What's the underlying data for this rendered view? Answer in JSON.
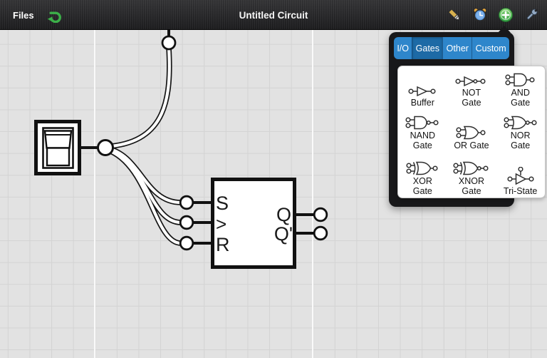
{
  "toolbar": {
    "files_label": "Files",
    "title": "Untitled Circuit",
    "icons": [
      "undo-arrow",
      "pen",
      "alarm-clock",
      "add-component",
      "wrench"
    ],
    "colors": {
      "undo_green": "#3cb049",
      "add_green": "#46b352",
      "bar_dark": "#1b1b1d"
    }
  },
  "palette": {
    "tabs": [
      {
        "label": "I/O",
        "selected": false
      },
      {
        "label": "Gates",
        "selected": true
      },
      {
        "label": "Other",
        "selected": false
      },
      {
        "label": "Custom",
        "selected": false
      }
    ],
    "selected_tab": "Gates",
    "items": [
      {
        "name": "buffer",
        "label": "Buffer"
      },
      {
        "name": "not-gate",
        "label": "NOT Gate"
      },
      {
        "name": "and-gate",
        "label": "AND Gate"
      },
      {
        "name": "nand-gate",
        "label": "NAND Gate"
      },
      {
        "name": "or-gate",
        "label": "OR Gate"
      },
      {
        "name": "nor-gate",
        "label": "NOR Gate"
      },
      {
        "name": "xor-gate",
        "label": "XOR Gate"
      },
      {
        "name": "xnor-gate",
        "label": "XNOR Gate"
      },
      {
        "name": "tri-state",
        "label": "Tri-State"
      }
    ],
    "colors": {
      "tab_bg": "#2e86cb",
      "tab_selected_bg": "#1d6aa6",
      "frame": "#18181a"
    }
  },
  "canvas": {
    "bg_color": "#e2e2e2",
    "grid_color": "#d3d3d3",
    "components": [
      "toggle-switch",
      "sr-flipflop"
    ],
    "flipflop": {
      "s": "S",
      "clock": ">",
      "r": "R",
      "q": "Q",
      "q_prime": "Q'"
    }
  }
}
